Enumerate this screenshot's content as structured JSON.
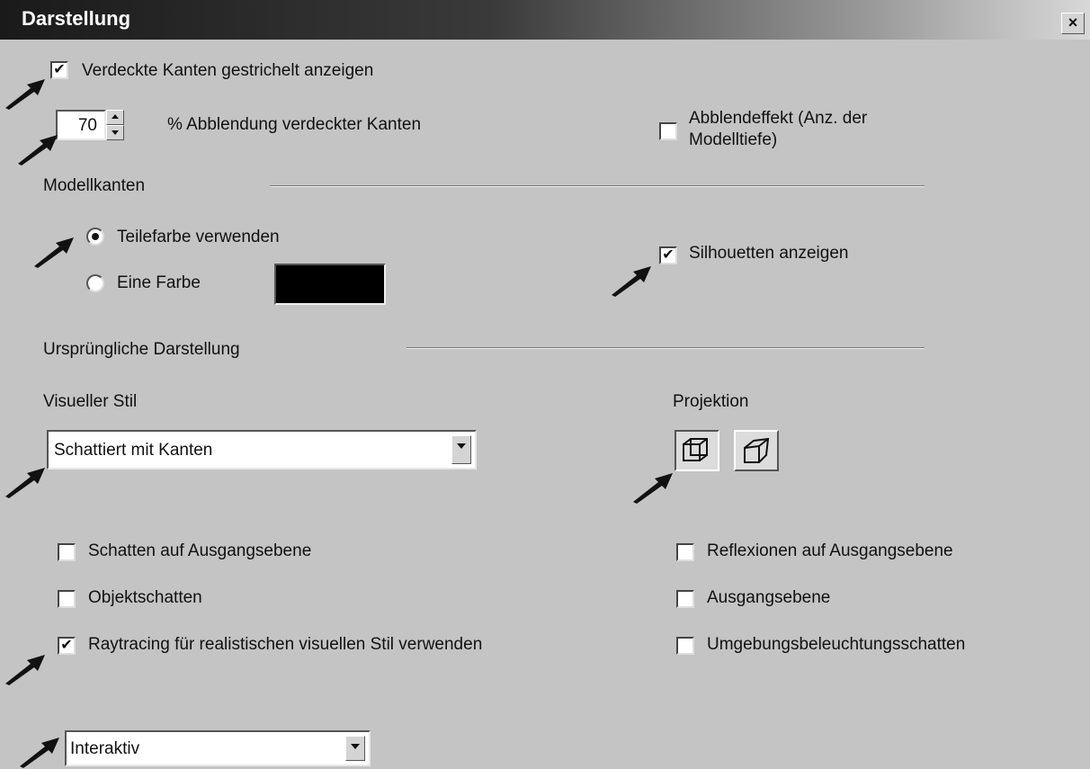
{
  "window": {
    "title": "Darstellung",
    "close_label": "×"
  },
  "hidden_edges": {
    "dashed_label": "Verdeckte Kanten gestrichelt anzeigen",
    "dashed_checked": true,
    "dim_value": "70",
    "dim_label": "% Abblendung verdeckter Kanten",
    "depth_label_line1": "Abblendeffekt (Anz. der",
    "depth_label_line2": "Modelltiefe)",
    "depth_checked": false
  },
  "model_edges": {
    "section_label": "Modellkanten",
    "part_color_label": "Teilefarbe verwenden",
    "part_color_selected": true,
    "one_color_label": "Eine Farbe",
    "one_color_selected": false,
    "color_value": "#000000",
    "silhouettes_label": "Silhouetten anzeigen",
    "silhouettes_checked": true
  },
  "initial_display": {
    "section_label": "Ursprüngliche Darstellung",
    "visual_style_label": "Visueller Stil",
    "visual_style_value": "Schattiert mit Kanten",
    "projection_label": "Projektion",
    "projection_buttons": [
      {
        "icon": "orthographic-cube-icon",
        "pressed": true
      },
      {
        "icon": "perspective-cube-icon",
        "pressed": false
      }
    ]
  },
  "options": {
    "ground_shadow_label": "Schatten auf Ausgangsebene",
    "ground_shadow_checked": false,
    "object_shadow_label": "Objektschatten",
    "object_shadow_checked": false,
    "raytracing_label": "Raytracing für realistischen visuellen Stil verwenden",
    "raytracing_checked": true,
    "reflections_label": "Reflexionen auf Ausgangsebene",
    "reflections_checked": false,
    "ground_plane_label": "Ausgangsebene",
    "ground_plane_checked": false,
    "ambient_occlusion_label": "Umgebungsbeleuchtungsschatten",
    "ambient_occlusion_checked": false,
    "quality_value": "Interaktiv"
  },
  "colors": {
    "dialog_bg": "#c4c4c4",
    "title_bar": "#1a1a1a",
    "pointer_arrow": "#111111"
  }
}
